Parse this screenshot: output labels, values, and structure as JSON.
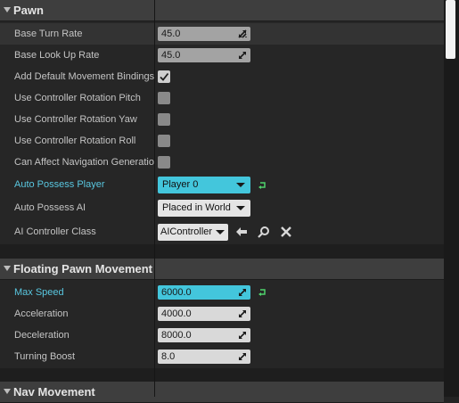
{
  "pawn": {
    "title": "Pawn",
    "base_turn_rate": {
      "label": "Base Turn Rate",
      "value": "45.0"
    },
    "base_look_up_rate": {
      "label": "Base Look Up Rate",
      "value": "45.0"
    },
    "add_default_bindings": {
      "label": "Add Default Movement Bindings",
      "checked": true
    },
    "use_ctrl_pitch": {
      "label": "Use Controller Rotation Pitch",
      "checked": false
    },
    "use_ctrl_yaw": {
      "label": "Use Controller Rotation Yaw",
      "checked": false
    },
    "use_ctrl_roll": {
      "label": "Use Controller Rotation Roll",
      "checked": false
    },
    "can_affect_nav": {
      "label": "Can Affect Navigation Generation",
      "checked": false
    },
    "auto_possess_player": {
      "label": "Auto Possess Player",
      "value": "Player 0"
    },
    "auto_possess_ai": {
      "label": "Auto Possess AI",
      "value": "Placed in World"
    },
    "ai_controller_class": {
      "label": "AI Controller Class",
      "value": "AIController"
    }
  },
  "floating": {
    "title": "Floating Pawn Movement",
    "max_speed": {
      "label": "Max Speed",
      "value": "6000.0"
    },
    "acceleration": {
      "label": "Acceleration",
      "value": "4000.0"
    },
    "deceleration": {
      "label": "Deceleration",
      "value": "8000.0"
    },
    "turning_boost": {
      "label": "Turning Boost",
      "value": "8.0"
    }
  },
  "nav": {
    "title": "Nav Movement"
  },
  "colors": {
    "accent_label": "#59c7e0",
    "cyan_field": "#43c6dc",
    "reset_arrow": "#4fd26b"
  },
  "icons": [
    "drag-handle-icon",
    "checkmark-icon",
    "reset-to-default-icon",
    "use-selected-arrow-icon",
    "browse-magnifier-icon",
    "clear-x-icon",
    "collapse-arrow-icon"
  ]
}
